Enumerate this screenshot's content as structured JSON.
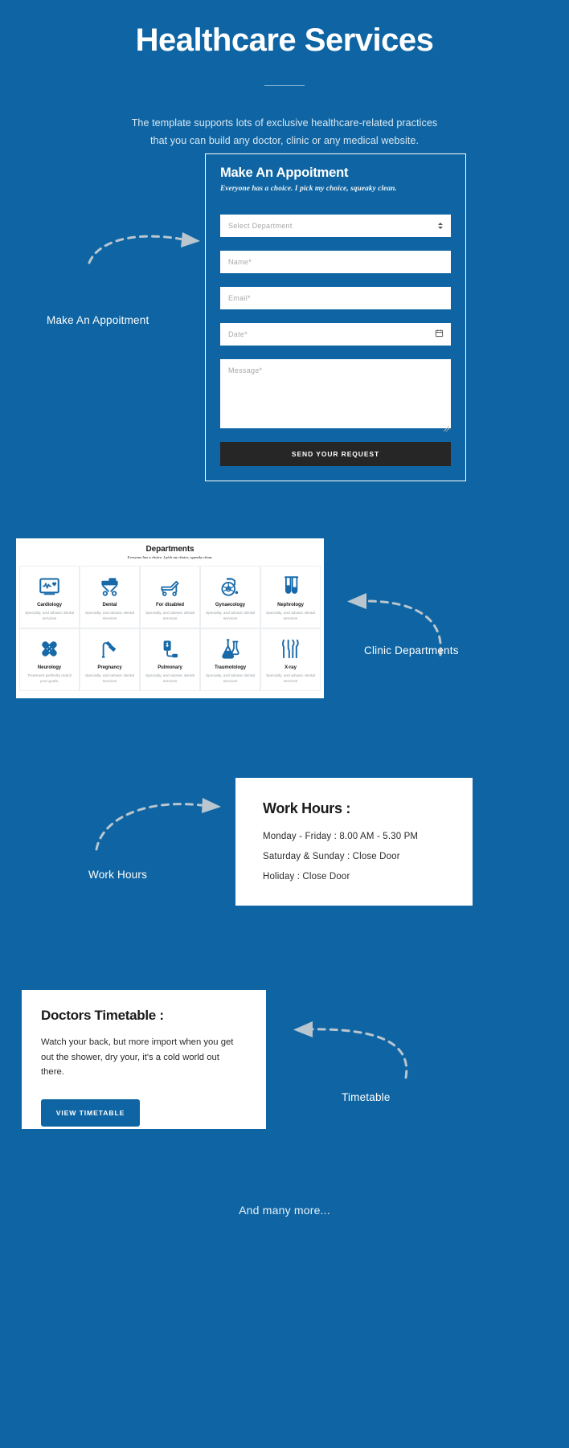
{
  "hero": {
    "title": "Healthcare Services",
    "subtitle_line1": "The template supports lots of exclusive healthcare-related practices",
    "subtitle_line2": "that you can build any doctor, clinic or any medical website."
  },
  "appointment": {
    "title": "Make An Appoitment",
    "slogan": "Everyone has a choice. I pick my choice, squeaky clean.",
    "select_placeholder": "Select Department",
    "name_placeholder": "Name*",
    "email_placeholder": "Email*",
    "date_placeholder": "Date*",
    "message_placeholder": "Message*",
    "submit_label": "SEND YOUR REQUEST"
  },
  "callouts": {
    "appointment": "Make An Appoitment",
    "departments": "Clinic Departments",
    "work_hours": "Work Hours",
    "timetable": "Timetable"
  },
  "departments": {
    "title": "Departments",
    "slogan": "Everyone has a choice. I pick my choice, squeaky clean.",
    "items": [
      {
        "name": "Cardiology",
        "desc": "Specialty, and advanc dental services",
        "icon": "heart-monitor-icon"
      },
      {
        "name": "Dental",
        "desc": "Specialty, and advanc dental services",
        "icon": "hospital-bed-icon"
      },
      {
        "name": "For disabled",
        "desc": "Specialty, and advanc dental services",
        "icon": "stretcher-icon"
      },
      {
        "name": "Gynaecology",
        "desc": "Specialty, and advanc dental services",
        "icon": "wheelchair-icon"
      },
      {
        "name": "Nephrology",
        "desc": "Specialty, and advanc dental services",
        "icon": "test-tubes-icon"
      },
      {
        "name": "Neurology",
        "desc": "Treatment perfectly match your goals.",
        "icon": "bandage-cross-icon"
      },
      {
        "name": "Pregnancy",
        "desc": "Specialty, and advanc dental services",
        "icon": "dental-lamp-icon"
      },
      {
        "name": "Pulmonary",
        "desc": "Specialty, and advanc dental services",
        "icon": "iv-drip-icon"
      },
      {
        "name": "Traumotology",
        "desc": "Specialty, and advanc dental services",
        "icon": "flasks-icon"
      },
      {
        "name": "X-ray",
        "desc": "Specialty, and advanc dental services",
        "icon": "instruments-icon"
      }
    ]
  },
  "work_hours": {
    "title": "Work Hours :",
    "rows": [
      "Monday - Friday : 8.00 AM - 5.30 PM",
      "Saturday & Sunday : Close Door",
      "Holiday : Close Door"
    ]
  },
  "timetable": {
    "title": "Doctors Timetable :",
    "body": "Watch your back, but more import when you get out the shower, dry your, it's a cold world out there.",
    "button_label": "VIEW TIMETABLE"
  },
  "footer": {
    "note": "And many more..."
  },
  "colors": {
    "background_blue": "#0f65a3",
    "icon_blue": "#1769a8",
    "submit_dark": "#262626",
    "arrow_gray": "#b9c6cf"
  }
}
